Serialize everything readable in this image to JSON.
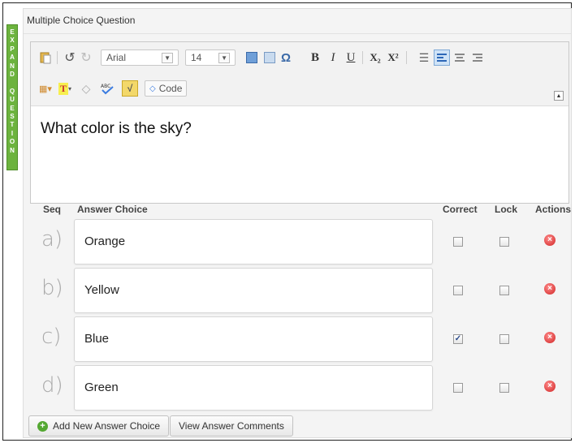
{
  "expand_tab": {
    "lines": [
      "E",
      "X",
      "P",
      "A",
      "N",
      "D",
      "",
      "Q",
      "U",
      "E",
      "S",
      "T",
      "I",
      "O",
      "N"
    ]
  },
  "panel": {
    "title": "Multiple Choice Question"
  },
  "toolbar": {
    "font_family": "Arial",
    "font_size": "14",
    "bold": "B",
    "italic": "I",
    "underline": "U",
    "subscript": "X₂",
    "superscript": "X²",
    "omega": "Ω",
    "code_label": "Code"
  },
  "editor": {
    "content": "What color is the sky?"
  },
  "columns": {
    "seq": "Seq",
    "answer": "Answer Choice",
    "correct": "Correct",
    "lock": "Lock",
    "actions": "Actions"
  },
  "answers": [
    {
      "seq": "a)",
      "text": "Orange",
      "correct": false,
      "lock": false
    },
    {
      "seq": "b)",
      "text": "Yellow",
      "correct": false,
      "lock": false
    },
    {
      "seq": "c)",
      "text": "Blue",
      "correct": true,
      "lock": false
    },
    {
      "seq": "d)",
      "text": "Green",
      "correct": false,
      "lock": false
    }
  ],
  "buttons": {
    "add": "Add New Answer Choice",
    "comments": "View Answer Comments"
  },
  "colors": {
    "expand_tab": "#6cb33e",
    "delete": "#d02525",
    "add_icon": "#54a832",
    "active_button": "#cfe3f7"
  }
}
